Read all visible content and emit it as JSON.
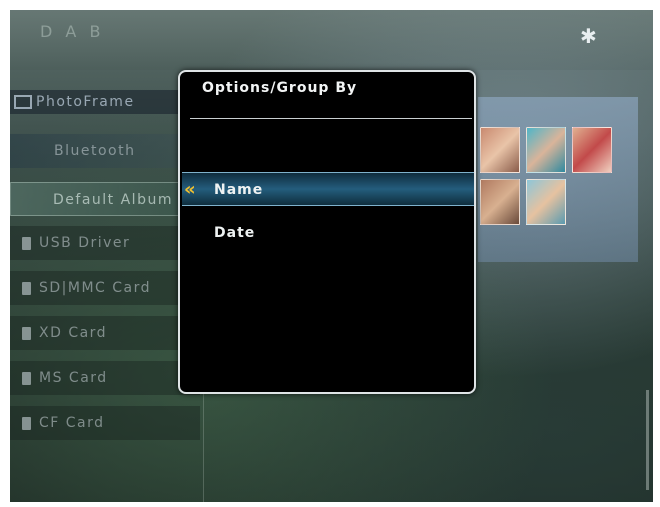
{
  "topbar": {
    "logo_text": "D A B",
    "bluetooth_icon": "bluetooth-icon"
  },
  "sidebar": {
    "header_label": "PhotoFrame",
    "items": [
      {
        "label": "Bluetooth"
      },
      {
        "label": "Default Album"
      },
      {
        "label": "USB Driver"
      },
      {
        "label": "SD|MMC Card"
      },
      {
        "label": "XD Card"
      },
      {
        "label": "MS Card"
      },
      {
        "label": "CF Card"
      }
    ]
  },
  "dialog": {
    "title": "Options/Group By",
    "options": [
      {
        "label": "Name",
        "selected": true
      },
      {
        "label": "Date",
        "selected": false
      }
    ],
    "selection_icon": "double-chevron-left-icon",
    "accent_color": "#f0c030"
  }
}
